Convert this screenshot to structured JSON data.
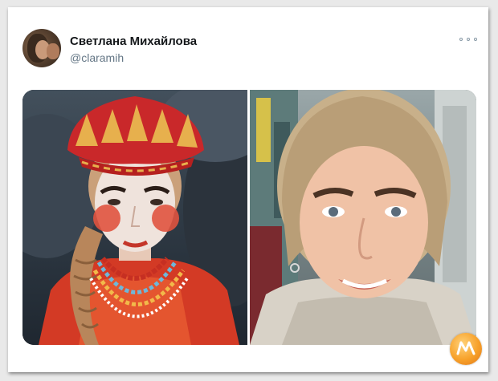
{
  "tweet": {
    "display_name": "Светлана Михайлова",
    "handle": "@claramih",
    "more_icon": "more-horizontal-icon"
  },
  "media": {
    "images": [
      "photo-left",
      "photo-right"
    ]
  },
  "colors": {
    "name": "#14171a",
    "handle": "#657786",
    "accent_watermark": "#f7a12a"
  }
}
